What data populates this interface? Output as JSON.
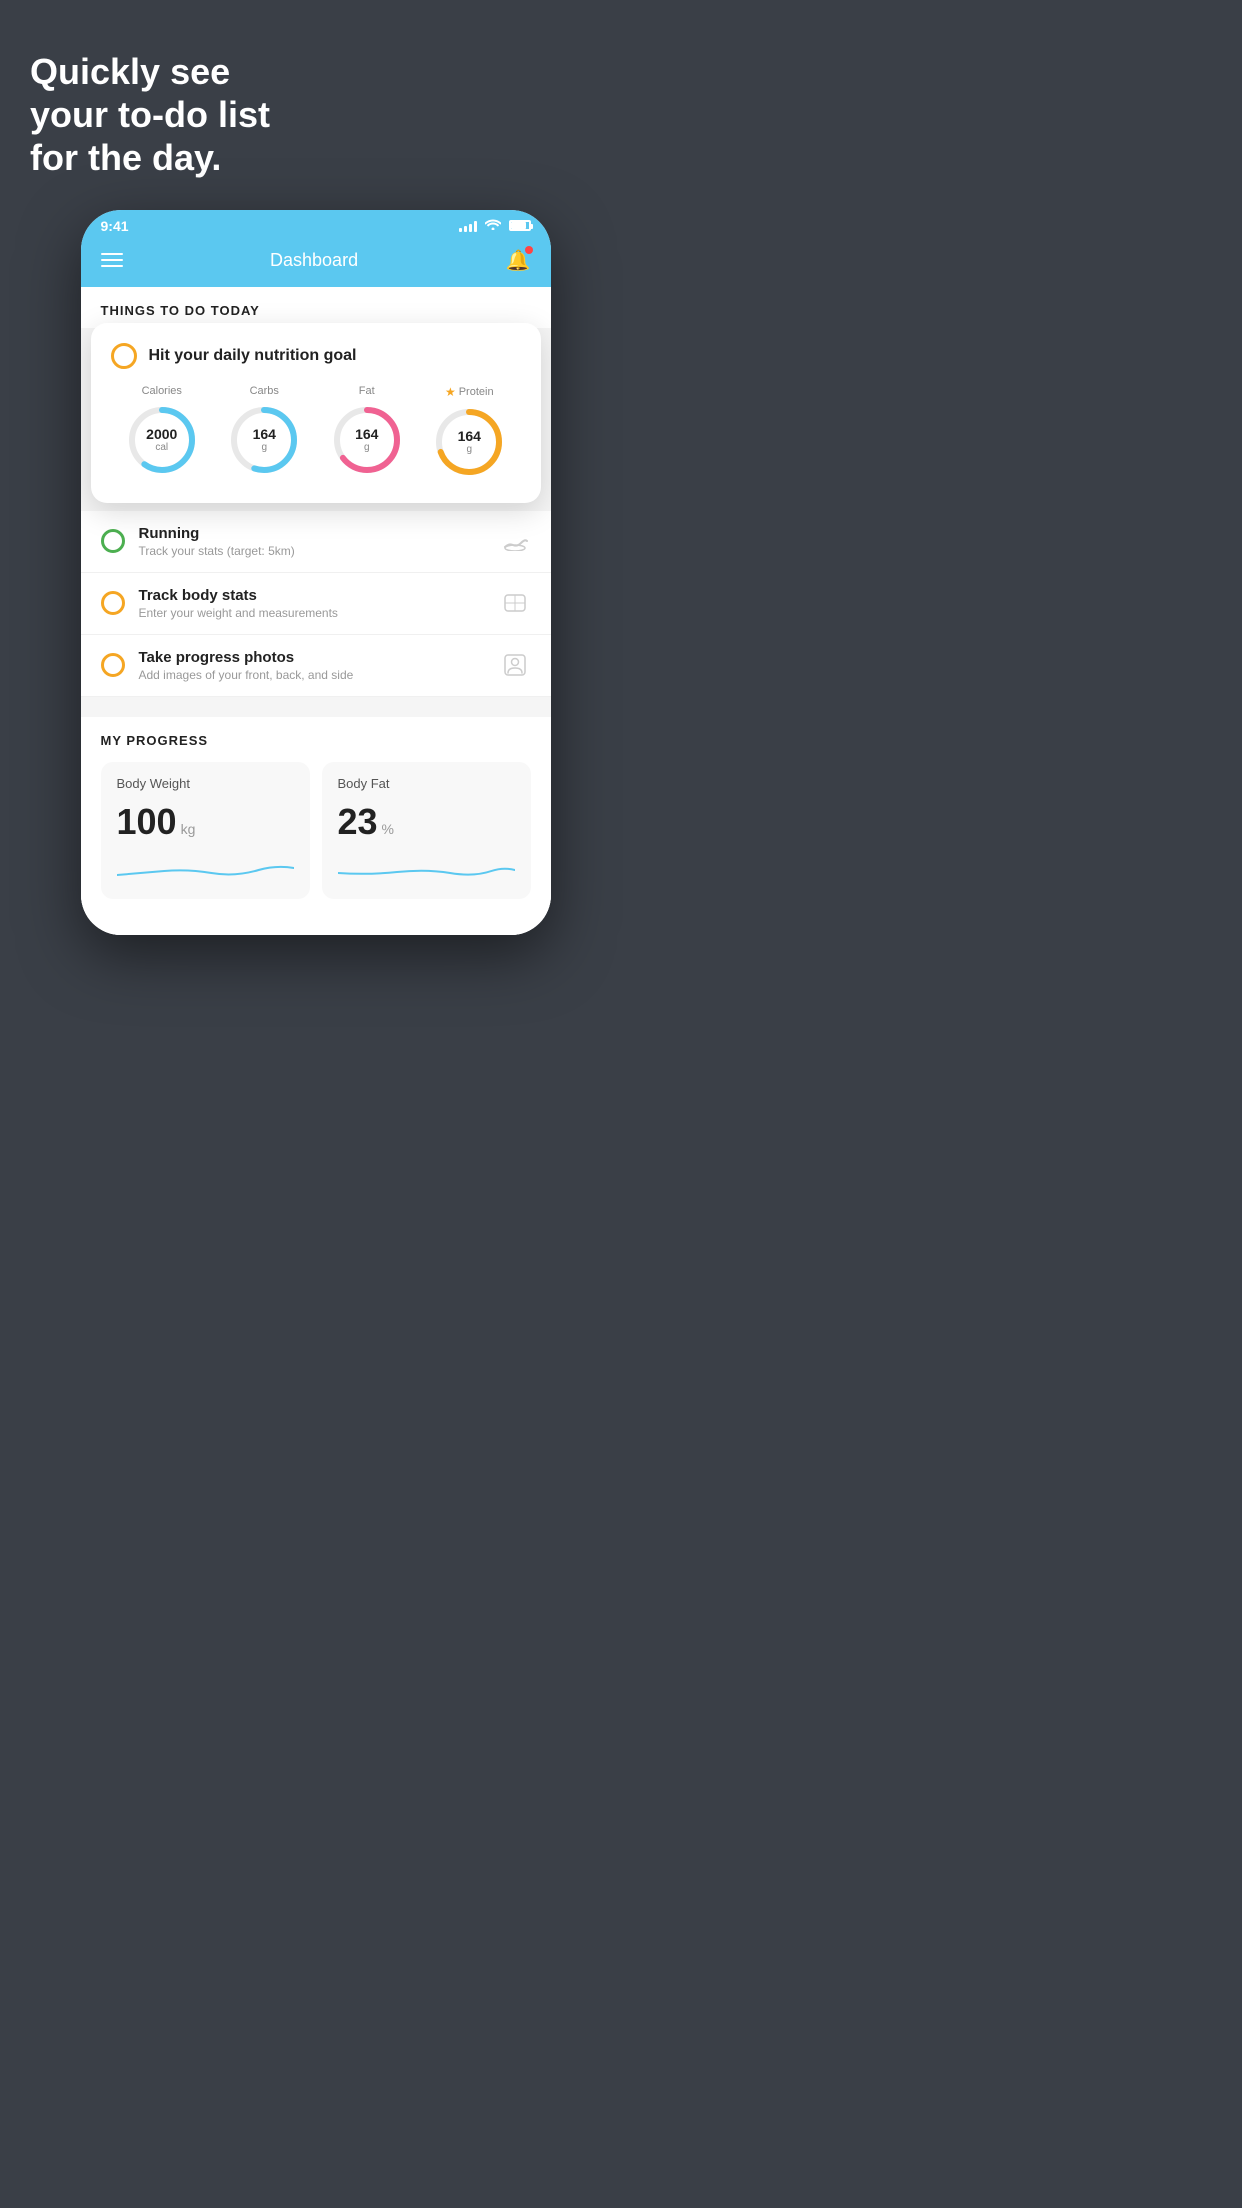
{
  "headline": {
    "line1": "Quickly see",
    "line2": "your to-do list",
    "line3": "for the day."
  },
  "statusBar": {
    "time": "9:41"
  },
  "header": {
    "title": "Dashboard"
  },
  "thingsToDo": {
    "sectionTitle": "THINGS TO DO TODAY"
  },
  "nutritionCard": {
    "title": "Hit your daily nutrition goal",
    "items": [
      {
        "label": "Calories",
        "value": "2000",
        "unit": "cal",
        "color": "#5bc8f0",
        "percent": 60,
        "star": false
      },
      {
        "label": "Carbs",
        "value": "164",
        "unit": "g",
        "color": "#5bc8f0",
        "percent": 55,
        "star": false
      },
      {
        "label": "Fat",
        "value": "164",
        "unit": "g",
        "color": "#f06292",
        "percent": 65,
        "star": false
      },
      {
        "label": "Protein",
        "value": "164",
        "unit": "g",
        "color": "#f5a623",
        "percent": 70,
        "star": true
      }
    ]
  },
  "todoItems": [
    {
      "title": "Running",
      "subtitle": "Track your stats (target: 5km)",
      "checkColor": "green",
      "icon": "shoe"
    },
    {
      "title": "Track body stats",
      "subtitle": "Enter your weight and measurements",
      "checkColor": "yellow",
      "icon": "scale"
    },
    {
      "title": "Take progress photos",
      "subtitle": "Add images of your front, back, and side",
      "checkColor": "yellow",
      "icon": "person"
    }
  ],
  "myProgress": {
    "sectionTitle": "MY PROGRESS",
    "cards": [
      {
        "title": "Body Weight",
        "value": "100",
        "unit": "kg"
      },
      {
        "title": "Body Fat",
        "value": "23",
        "unit": "%"
      }
    ]
  }
}
